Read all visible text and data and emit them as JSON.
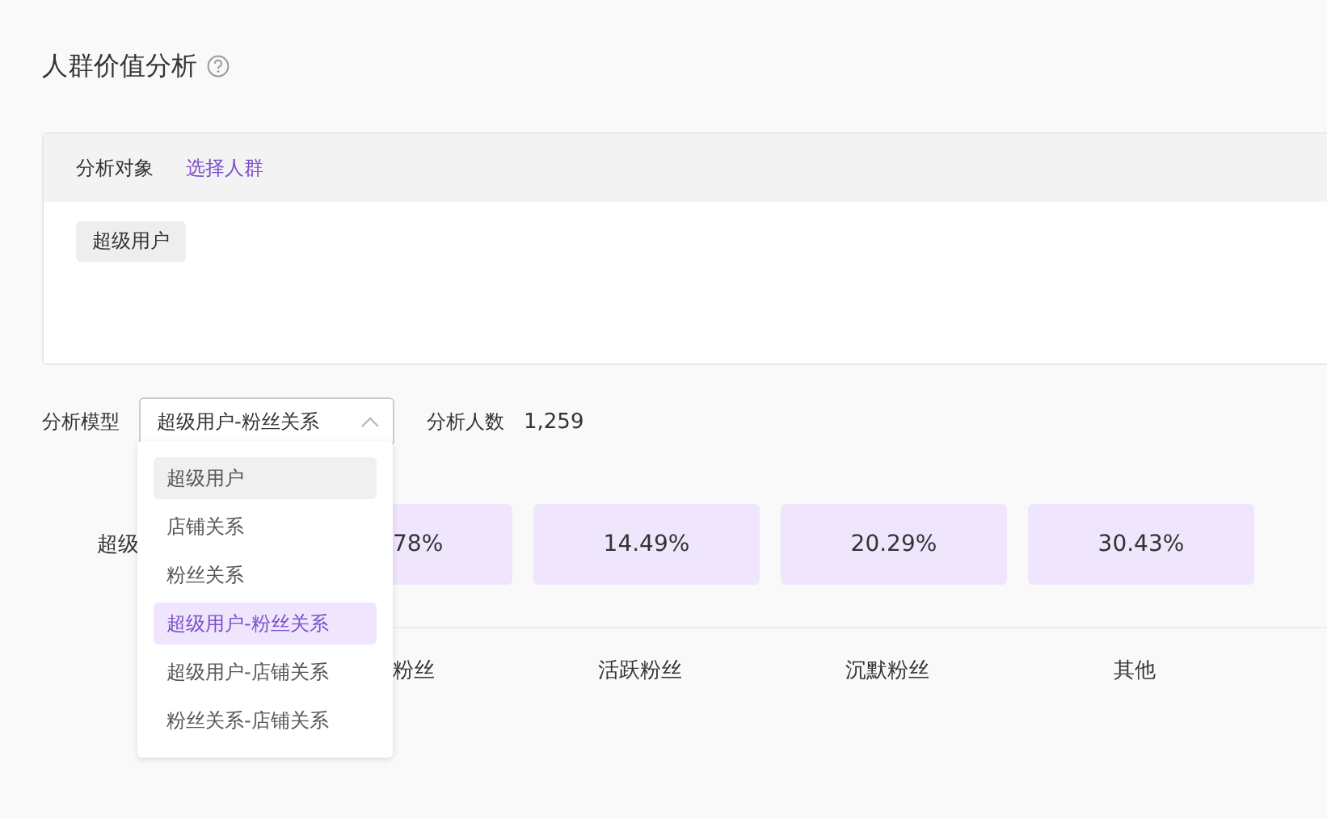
{
  "title": "人群价值分析",
  "target": {
    "label": "分析对象",
    "link": "选择人群",
    "tags": [
      "超级用户"
    ]
  },
  "model": {
    "label": "分析模型",
    "value": "超级用户-粉丝关系",
    "expanded": true,
    "count_label": "分析人数",
    "count": "1,259"
  },
  "dropdown": [
    {
      "label": "超级用户",
      "selected": false,
      "hovered": true
    },
    {
      "label": "店铺关系",
      "selected": false,
      "hovered": false
    },
    {
      "label": "粉丝关系",
      "selected": false,
      "hovered": false
    },
    {
      "label": "超级用户-粉丝关系",
      "selected": true,
      "hovered": false
    },
    {
      "label": "超级用户-店铺关系",
      "selected": false,
      "hovered": false
    },
    {
      "label": "粉丝关系-店铺关系",
      "selected": false,
      "hovered": false
    }
  ],
  "grid": {
    "row_label": "超级",
    "cells": [
      "78%",
      "14.49%",
      "20.29%",
      "30.43%"
    ],
    "columns": [
      "粉丝",
      "活跃粉丝",
      "沉默粉丝",
      "其他"
    ]
  }
}
